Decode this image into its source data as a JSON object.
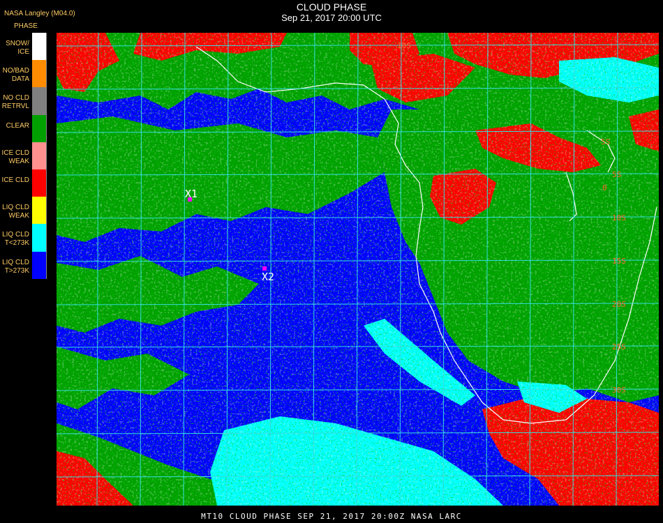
{
  "header": {
    "source": "NASA Langley (M04.0)",
    "legend_title": "PHASE",
    "title": "CLOUD PHASE",
    "subtitle": "Sep 21, 2017 20:00 UTC"
  },
  "legend": [
    {
      "label": "SNOW/\nICE",
      "color": "#ffffff"
    },
    {
      "label": "NO/BAD\nDATA",
      "color": "#ff8c00"
    },
    {
      "label": "NO CLD\nRETRVL",
      "color": "#808080"
    },
    {
      "label": "CLEAR",
      "color": "#00a000"
    },
    {
      "label": "ICE CLD\nWEAK",
      "color": "#ff9090"
    },
    {
      "label": "ICE CLD",
      "color": "#ff0000"
    },
    {
      "label": "LIQ CLD\nWEAK",
      "color": "#ffff00"
    },
    {
      "label": "LIQ CLD\nT<273K",
      "color": "#00ffff"
    },
    {
      "label": "LIQ CLD\nT>273K",
      "color": "#0000ff"
    }
  ],
  "markers": [
    {
      "label": "X1"
    },
    {
      "label": "X2"
    }
  ],
  "grid_labels": [
    "10S",
    "5S",
    "0",
    "5S",
    "10S",
    "15S",
    "20S",
    "25S",
    "30S"
  ],
  "footer": "MT10  CLOUD PHASE   SEP 21, 2017 20:00Z   NASA LARC"
}
